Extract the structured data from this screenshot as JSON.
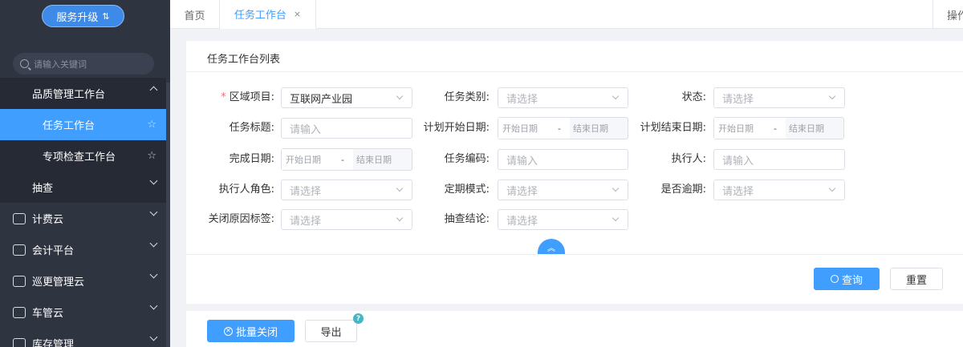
{
  "sidebar": {
    "upgrade_label": "服务升级",
    "search_placeholder": "请输入关键词",
    "group_quality": "品质管理工作台",
    "item_task": "任务工作台",
    "item_special": "专项检查工作台",
    "group_sampling": "抽查",
    "menu_billing": "计费云",
    "menu_accounting": "会计平台",
    "menu_patrol": "巡更管理云",
    "menu_vehicle": "车管云",
    "menu_inventory": "库存管理"
  },
  "header": {
    "tab_home": "首页",
    "tab_current": "任务工作台",
    "tab_close": "×",
    "ops": "操作"
  },
  "card": {
    "title": "任务工作台列表"
  },
  "form": {
    "area_label": "区域项目:",
    "area_required": "*",
    "area_value": "互联网产业园",
    "task_type_label": "任务类别:",
    "status_label": "状态:",
    "task_title_label": "任务标题:",
    "plan_start_label": "计划开始日期:",
    "plan_end_label": "计划结束日期:",
    "finish_date_label": "完成日期:",
    "task_code_label": "任务编码:",
    "executor_label": "执行人:",
    "executor_role_label": "执行人角色:",
    "periodic_label": "定期模式:",
    "overdue_label": "是否逾期:",
    "close_reason_label": "关闭原因标签:",
    "check_result_label": "抽查结论:",
    "select_placeholder": "请选择",
    "input_placeholder": "请输入",
    "start_date_placeholder": "开始日期",
    "end_date_placeholder": "结束日期",
    "range_separator": "-"
  },
  "actions": {
    "query": "查询",
    "reset": "重置",
    "batch_close": "批量关闭",
    "export": "导出",
    "help_mark": "?"
  }
}
